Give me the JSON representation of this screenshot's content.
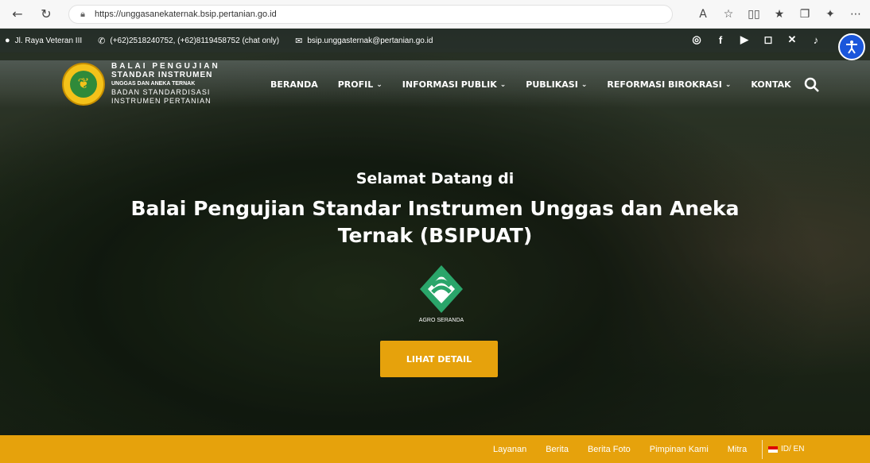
{
  "browser": {
    "url": "https://unggasanekaternak.bsip.pertanian.go.id",
    "read_aloud_label": "A",
    "icons": [
      "back-icon",
      "refresh-icon",
      "lock-icon",
      "read-aloud-icon",
      "favorite-icon",
      "split-screen-icon",
      "favorites-bar-icon",
      "collections-icon",
      "extensions-icon",
      "more-icon"
    ]
  },
  "topbar": {
    "address": "Jl. Raya Veteran III",
    "phone": "(+62)2518240752, (+62)8119458752 (chat only)",
    "email": "bsip.unggasternak@pertanian.go.id",
    "socials": [
      "whatsapp-icon",
      "facebook-icon",
      "youtube-icon",
      "instagram-icon",
      "x-icon",
      "tiktok-icon"
    ]
  },
  "logo": {
    "line1": "BALAI PENGUJIAN",
    "line2": "STANDAR INSTRUMEN",
    "line3": "UNGGAS DAN ANEKA TERNAK",
    "line4": "BADAN STANDARDISASI",
    "line5": "INSTRUMEN PERTANIAN"
  },
  "menu": {
    "items": [
      {
        "label": "BERANDA",
        "dropdown": false
      },
      {
        "label": "PROFIL",
        "dropdown": true
      },
      {
        "label": "INFORMASI PUBLIK",
        "dropdown": true
      },
      {
        "label": "PUBLIKASI",
        "dropdown": true
      },
      {
        "label": "REFORMASI BIROKRASI",
        "dropdown": true
      },
      {
        "label": "KONTAK",
        "dropdown": false
      }
    ]
  },
  "hero": {
    "welcome": "Selamat Datang di",
    "title_line1": "Balai Pengujian Standar Instrumen Unggas dan Aneka",
    "title_line2": "Ternak (BSIPUAT)",
    "logo_caption": "AGRO SERANDA",
    "button": "LIHAT DETAIL"
  },
  "footer": {
    "links": [
      "Layanan",
      "Berita",
      "Berita Foto",
      "Pimpinan Kami",
      "Mitra"
    ],
    "language": "ID/ EN"
  },
  "colors": {
    "accent": "#e6a20c",
    "a11y": "#1a56db"
  }
}
